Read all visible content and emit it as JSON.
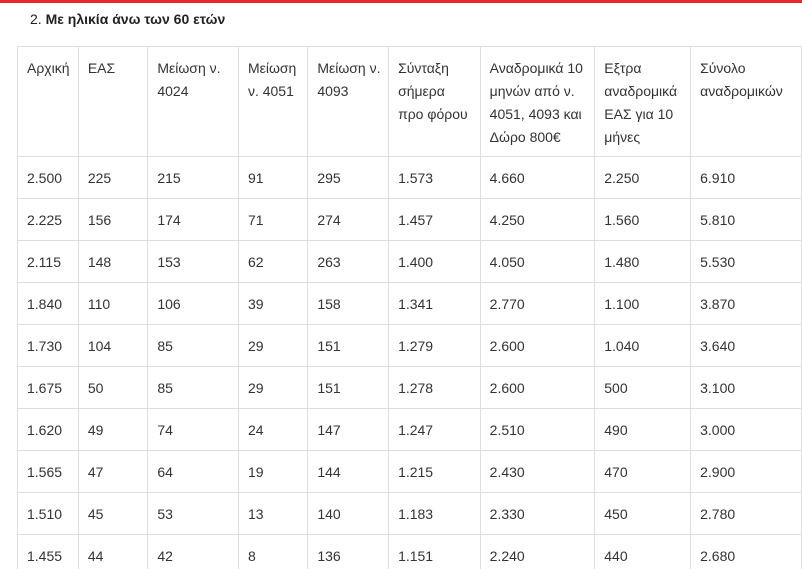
{
  "section": {
    "number": "2.",
    "title": "Με ηλικία άνω των 60 ετών"
  },
  "table": {
    "headers": [
      "Αρχική",
      "ΕΑΣ",
      "Μείωση ν. 4024",
      "Μείωση ν. 4051",
      "Μείωση ν. 4093",
      "Σύνταξη σήμερα προ φόρου",
      "Αναδρομικά 10 μηνών από ν. 4051, 4093 και Δώρο 800€",
      "Εξτρα αναδρομικά ΕΑΣ για 10 μήνες",
      "Σύνολο αναδρομικών"
    ],
    "rows": [
      [
        "2.500",
        "225",
        "215",
        "91",
        "295",
        "1.573",
        "4.660",
        "2.250",
        "6.910"
      ],
      [
        "2.225",
        "156",
        "174",
        "71",
        "274",
        "1.457",
        "4.250",
        "1.560",
        "5.810"
      ],
      [
        "2.115",
        "148",
        "153",
        "62",
        "263",
        "1.400",
        "4.050",
        "1.480",
        "5.530"
      ],
      [
        "1.840",
        "110",
        "106",
        "39",
        "158",
        "1.341",
        "2.770",
        "1.100",
        "3.870"
      ],
      [
        "1.730",
        "104",
        "85",
        "29",
        "151",
        "1.279",
        "2.600",
        "1.040",
        "3.640"
      ],
      [
        "1.675",
        "50",
        "85",
        "29",
        "151",
        "1.278",
        "2.600",
        "500",
        "3.100"
      ],
      [
        "1.620",
        "49",
        "74",
        "24",
        "147",
        "1.247",
        "2.510",
        "490",
        "3.000"
      ],
      [
        "1.565",
        "47",
        "64",
        "19",
        "144",
        "1.215",
        "2.430",
        "470",
        "2.900"
      ],
      [
        "1.510",
        "45",
        "53",
        "13",
        "140",
        "1.183",
        "2.330",
        "450",
        "2.780"
      ],
      [
        "1.455",
        "44",
        "42",
        "8",
        "136",
        "1.151",
        "2.240",
        "440",
        "2.680"
      ]
    ]
  }
}
